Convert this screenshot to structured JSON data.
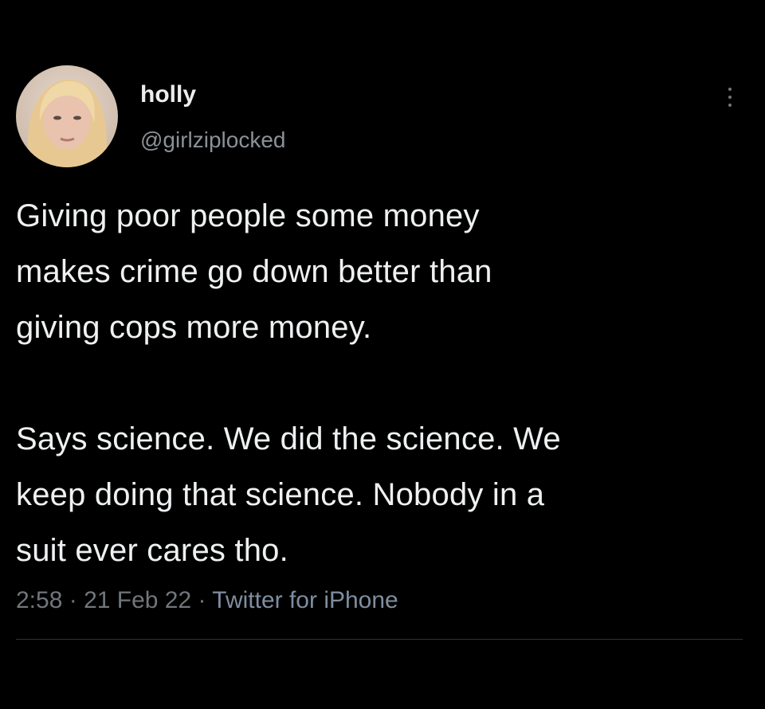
{
  "tweet": {
    "author": {
      "display_name": "holly",
      "handle": "@girlziplocked",
      "avatar": "avatar-photo"
    },
    "text": {
      "paragraph_1": "Giving poor people some money\nmakes crime go down better than\ngiving cops more money.",
      "paragraph_2": "Says science. We did the science. We\nkeep doing that science. Nobody in a\nsuit ever cares tho."
    },
    "meta": {
      "time": "2:58",
      "separator": " · ",
      "date": "21 Feb 22",
      "source": "Twitter for iPhone"
    },
    "icons": {
      "more": "more-vertical-icon"
    },
    "colors": {
      "background": "#000000",
      "text": "#e7e9ea",
      "secondary": "#71767b",
      "divider": "#2f3336"
    }
  }
}
